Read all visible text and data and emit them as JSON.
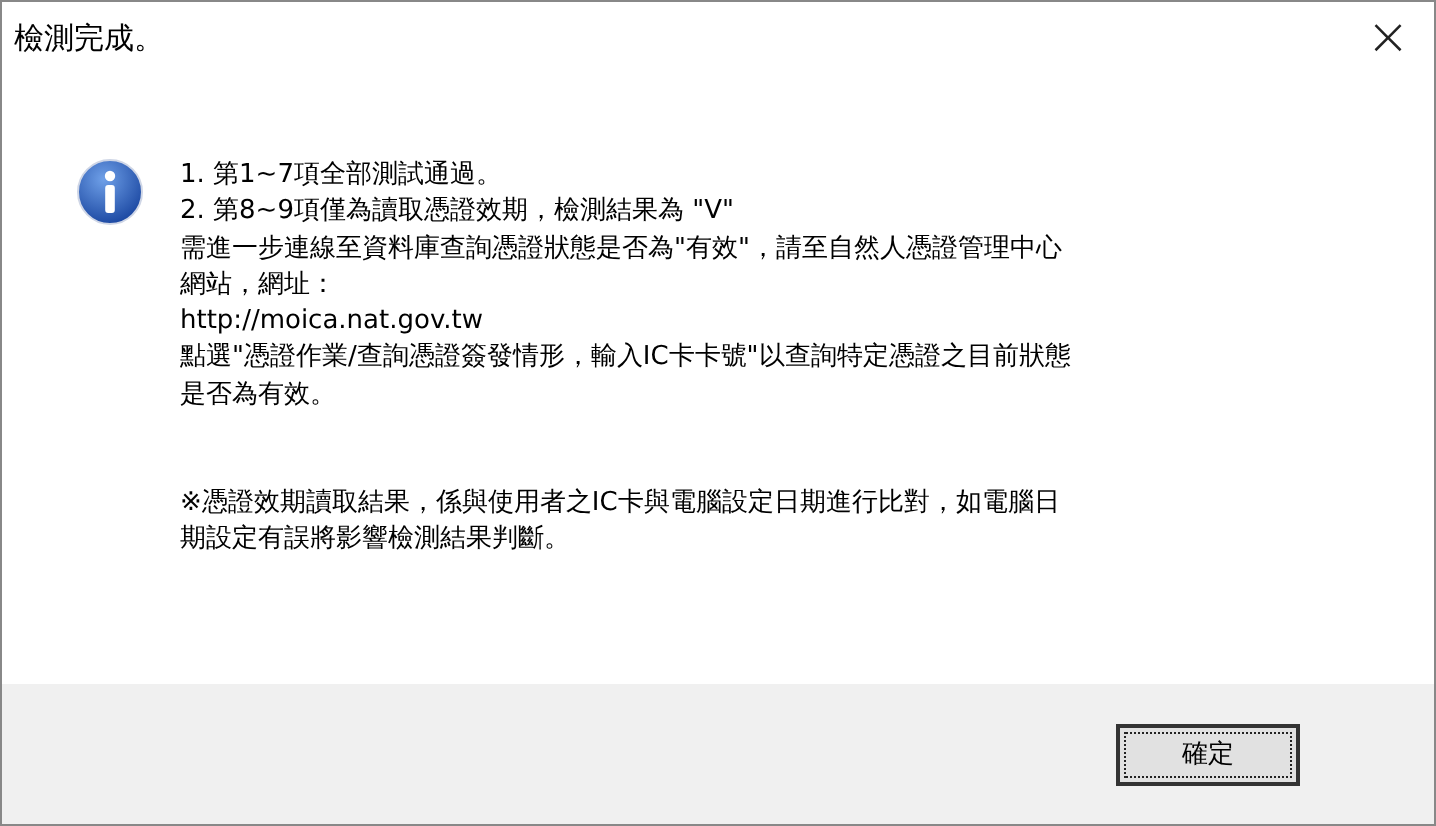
{
  "window": {
    "title": "檢測完成。",
    "close_glyph": "×"
  },
  "message_lines": [
    "1. 第1~7項全部測試通過。",
    "2. 第8~9項僅為讀取憑證效期，檢測結果為 \"V\"",
    "需進一步連線至資料庫查詢憑證狀態是否為\"有效\"，請至自然人憑證管理中心",
    "網站，網址：",
    "http://moica.nat.gov.tw",
    "點選\"憑證作業/查詢憑證簽發情形，輸入IC卡卡號\"以查詢特定憑證之目前狀態",
    "是否為有效。"
  ],
  "note_lines": [
    "※憑證效期讀取結果，係與使用者之IC卡與電腦設定日期進行比對，如電腦日",
    "期設定有誤將影響檢測結果判斷。"
  ],
  "buttons": [
    {
      "label": "確定",
      "selected": true
    }
  ]
}
